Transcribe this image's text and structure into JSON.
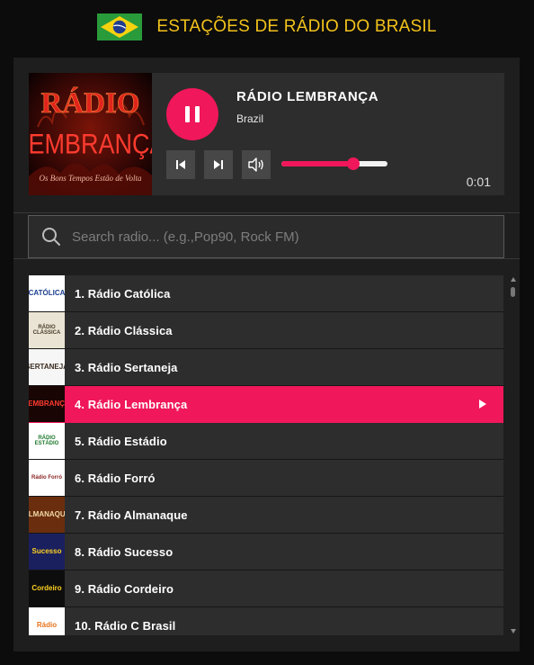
{
  "header": {
    "title": "ESTAÇÕES DE RÁDIO DO BRASIL",
    "flag_icon": "brazil-flag-icon",
    "accent_color": "#f2c21b"
  },
  "player": {
    "cover": {
      "line1": "RÁDIO",
      "line2": "LEMBRANÇA",
      "tagline": "Os Bons Tempos Estão de Volta"
    },
    "station_name": "RÁDIO LEMBRANÇA",
    "country": "Brazil",
    "state": "playing",
    "time": "0:01",
    "volume_percent": 68,
    "accent_color": "#f0175a",
    "icons": {
      "play_pause": "pause-icon",
      "prev": "skip-previous-icon",
      "next": "skip-next-icon",
      "volume": "volume-icon"
    }
  },
  "search": {
    "placeholder": "Search radio... (e.g.,Pop90, Rock FM)",
    "value": "",
    "icon": "search-icon"
  },
  "stations": [
    {
      "label": "1.  Rádio Católica",
      "thumb_text": "CATÓLICA",
      "thumb_bg": "#ffffff",
      "thumb_fg": "#1b3f8f",
      "active": false
    },
    {
      "label": "2.  Rádio Clássica",
      "thumb_text": "RÁDIO CLÁSSICA",
      "thumb_bg": "#eae4d4",
      "thumb_fg": "#4a3d2a",
      "active": false
    },
    {
      "label": "3.  Rádio Sertaneja",
      "thumb_text": "SERTANEJA",
      "thumb_bg": "#f6f6f6",
      "thumb_fg": "#3a2b1e",
      "active": false
    },
    {
      "label": "4.  Rádio Lembrança",
      "thumb_text": "LEMBRANÇA",
      "thumb_bg": "#1a0505",
      "thumb_fg": "#ff3b30",
      "active": true
    },
    {
      "label": "5.  Rádio Estádio",
      "thumb_text": "RÁDIO ESTÁDIO",
      "thumb_bg": "#ffffff",
      "thumb_fg": "#1f7a2e",
      "active": false
    },
    {
      "label": "6.  Rádio Forró",
      "thumb_text": "Rádio Forró",
      "thumb_bg": "#ffffff",
      "thumb_fg": "#8a1f1f",
      "active": false
    },
    {
      "label": "7.  Rádio Almanaque",
      "thumb_text": "ALMANAQUE",
      "thumb_bg": "#6a2e0e",
      "thumb_fg": "#f0d9a8",
      "active": false
    },
    {
      "label": "8.  Rádio Sucesso",
      "thumb_text": "Sucesso",
      "thumb_bg": "#1a1f5e",
      "thumb_fg": "#ffd21f",
      "active": false
    },
    {
      "label": "9.  Rádio Cordeiro",
      "thumb_text": "Cordeiro",
      "thumb_bg": "#0d0d0d",
      "thumb_fg": "#ffd21f",
      "active": false
    },
    {
      "label": "10.  Rádio C Brasil",
      "thumb_text": "Rádio",
      "thumb_bg": "#ffffff",
      "thumb_fg": "#e8731c",
      "active": false
    }
  ]
}
